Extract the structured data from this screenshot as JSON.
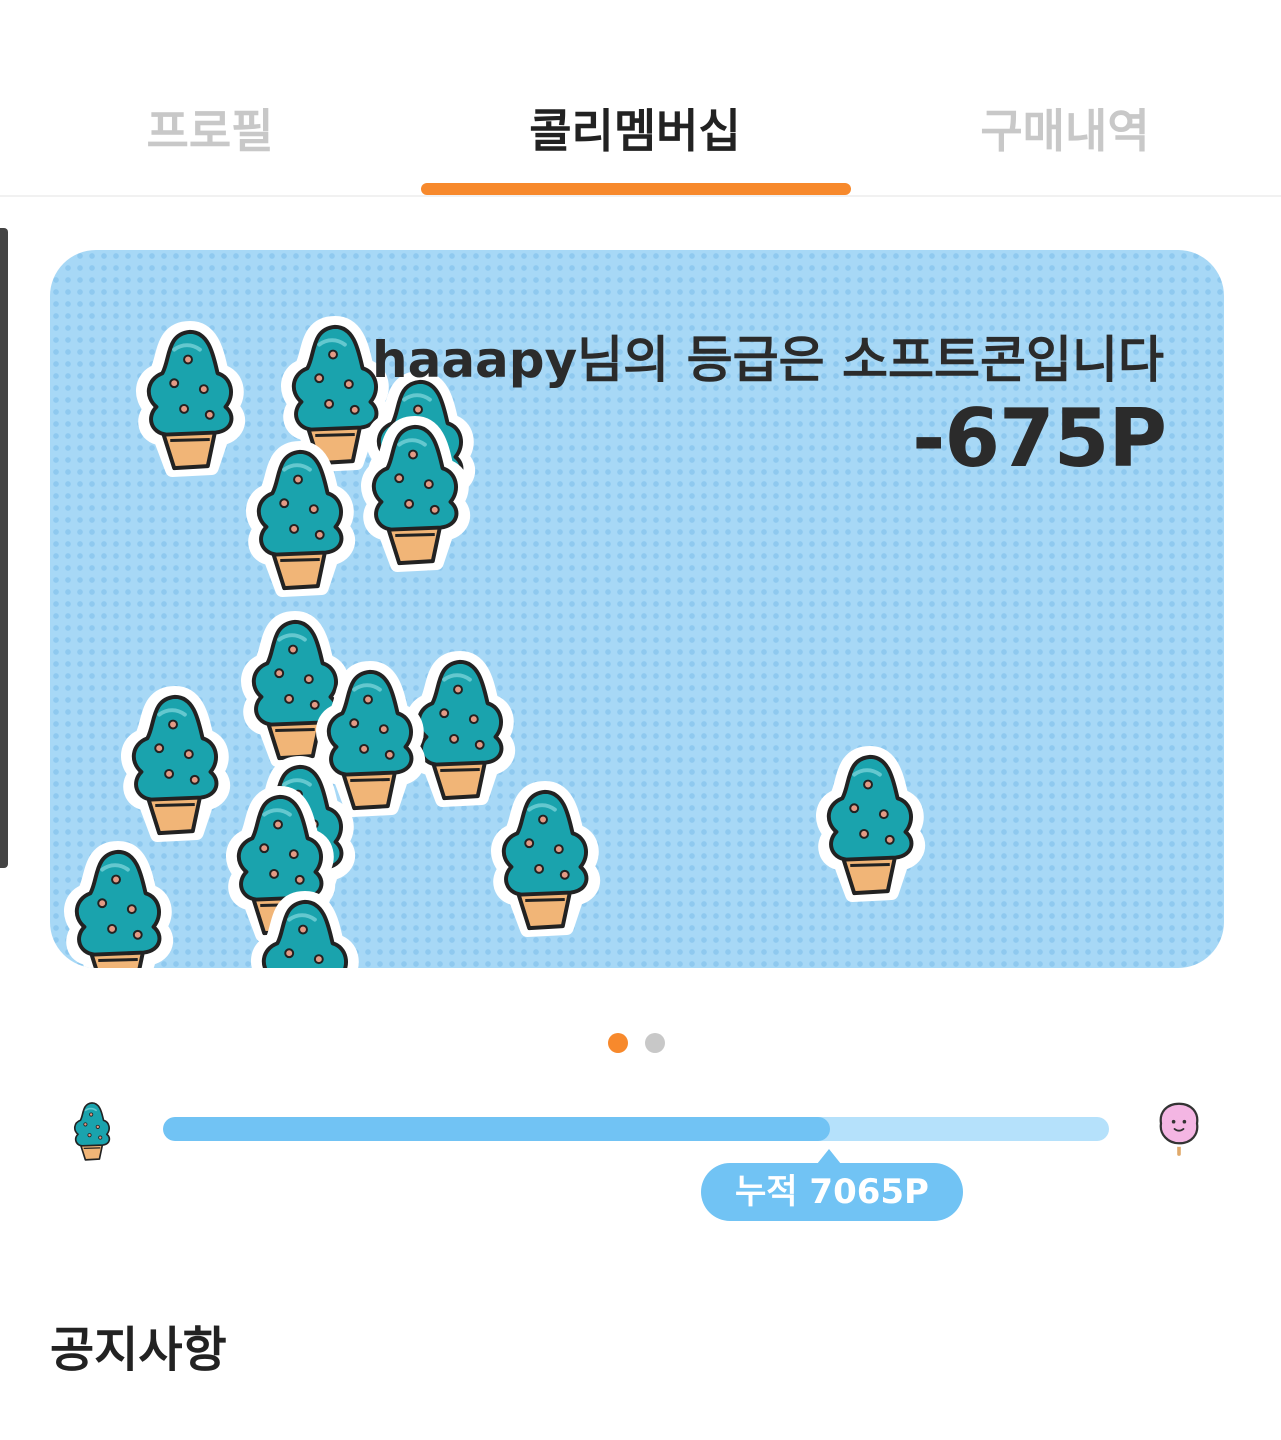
{
  "tabs": [
    {
      "label": "프로필",
      "active": false
    },
    {
      "label": "콜리멤버십",
      "active": true
    },
    {
      "label": "구매내역",
      "active": false
    }
  ],
  "card": {
    "grade_text": "haaapy님의 등급은 소프트콘입니다",
    "points": "-675P",
    "sticker_icon": "soft-cone-icon"
  },
  "carousel": {
    "count": 2,
    "active_index": 0
  },
  "progress": {
    "start_icon": "soft-cone-icon",
    "end_icon": "cotton-candy-icon",
    "fill_fraction": 0.705,
    "label": "누적 7065P"
  },
  "notice": {
    "title": "공지사항"
  },
  "colors": {
    "accent": "#f7892c",
    "card_bg": "#a7d8f6",
    "progress_fill": "#71c3f4",
    "progress_track": "#b5e1fb",
    "cone_cream": "#1aa3ad",
    "cone_wafer": "#f1b577"
  }
}
